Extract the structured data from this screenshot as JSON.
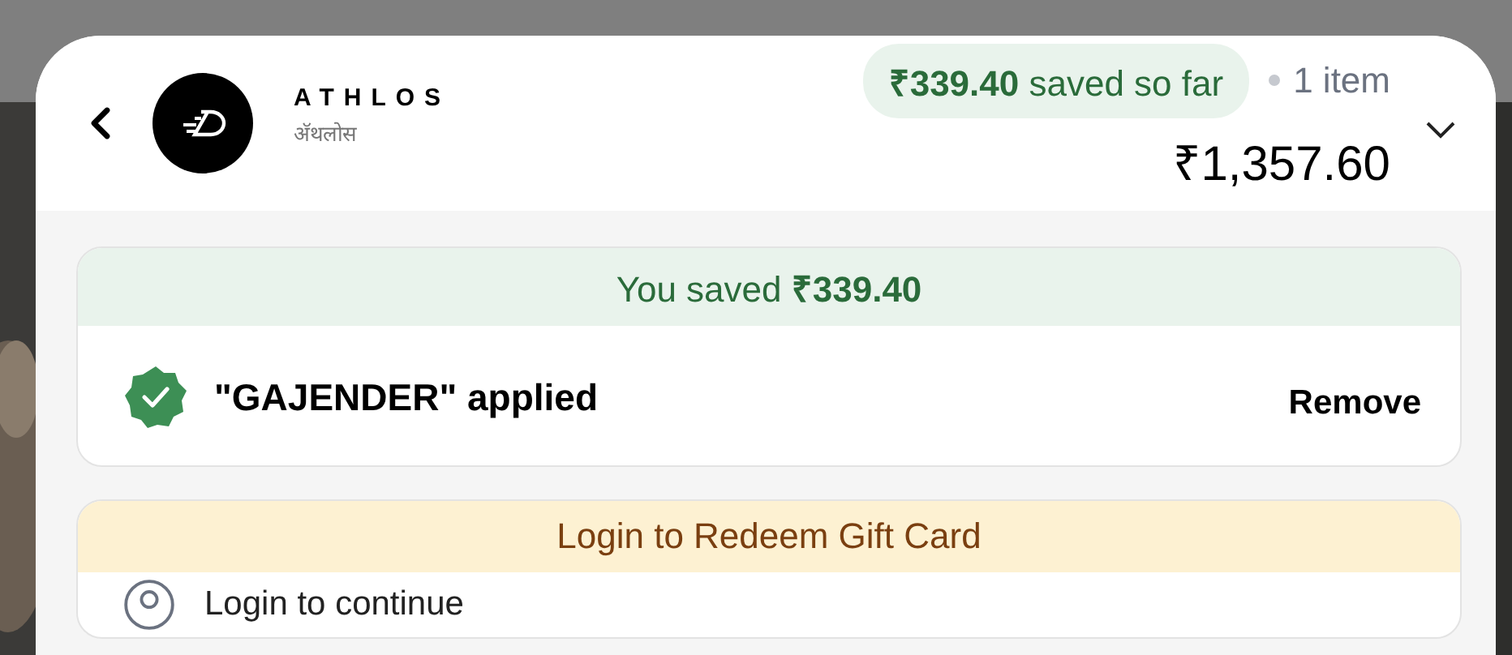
{
  "header": {
    "brand_name": "ATHLOS",
    "brand_subtitle": "अ‍ॅथलोस",
    "savings": "**₹339.40** saved so far",
    "item_count": "1 item",
    "total": "₹1,357.60",
    "expanded": false
  },
  "coupon": {
    "banner": "You saved **₹339.40**",
    "code_text": "\"GAJENDER\" applied",
    "applied": true,
    "action": "Remove"
  },
  "gift_card": {
    "banner": "Login to Redeem Gift Card",
    "row_text": "Login to continue"
  }
}
